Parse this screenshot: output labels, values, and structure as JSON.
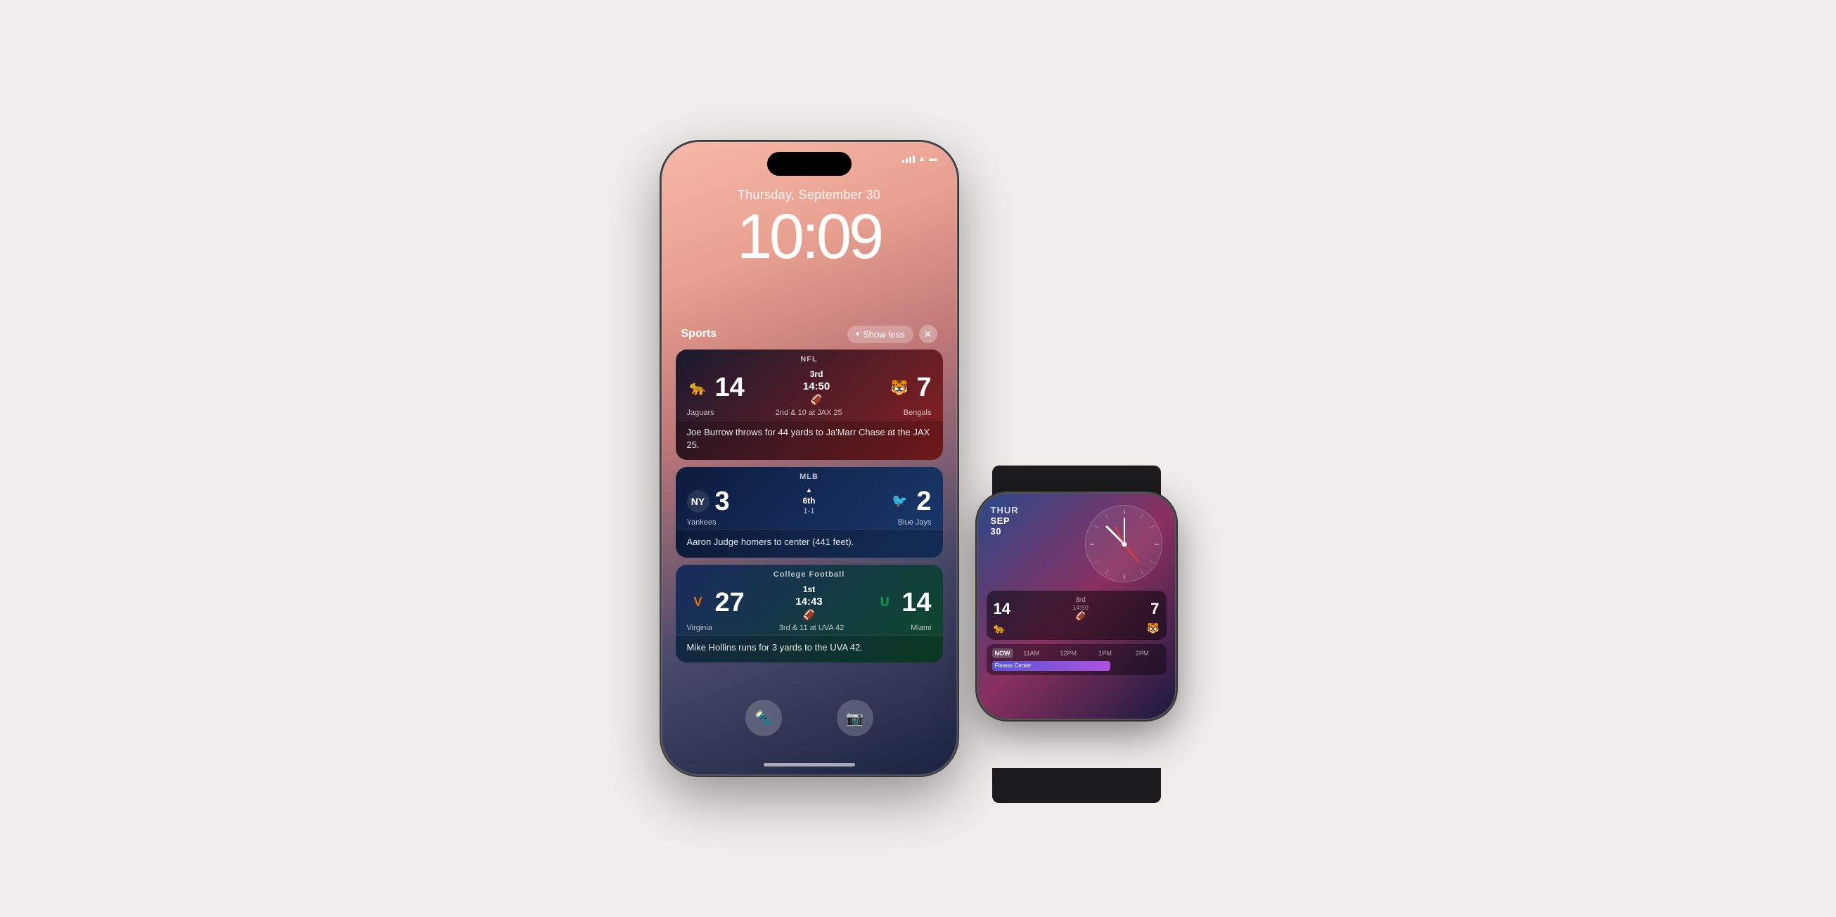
{
  "background_color": "#f0eeec",
  "iphone": {
    "date": "Thursday, September 30",
    "time": "10:09",
    "sports_label": "Sports",
    "show_less": "Show less",
    "nfl": {
      "league": "NFL",
      "team1": "Jaguars",
      "team1_score": "14",
      "team1_logo": "🐆",
      "team2": "Bengals",
      "team2_score": "7",
      "team2_logo": "🐯",
      "quarter": "3rd",
      "time": "14:50",
      "down_distance": "2nd & 10 at JAX 25",
      "play": "Joe Burrow throws for 44 yards to Ja'Marr Chase at the JAX 25."
    },
    "mlb": {
      "league": "MLB",
      "team1": "Yankees",
      "team1_score": "3",
      "team1_logo": "NY",
      "team2": "Blue Jays",
      "team2_score": "2",
      "team2_logo": "🐦",
      "inning": "6th",
      "inning_half": "▲",
      "count": "1-1",
      "play": "Aaron Judge homers to center (441 feet)."
    },
    "cfb": {
      "league": "College Football",
      "team1": "Virginia",
      "team1_score": "27",
      "team1_logo": "V",
      "team2": "Miami",
      "team2_score": "14",
      "team2_logo": "U",
      "quarter": "1st",
      "time": "14:43",
      "down_distance": "3rd & 11 at UVA 42",
      "play": "Mike Hollins runs for 3 yards to the UVA 42."
    }
  },
  "watch": {
    "day": "THUR",
    "month": "SEP",
    "date_num": "30",
    "nfl_score1": "14",
    "nfl_score2": "7",
    "nfl_quarter": "3rd",
    "nfl_time": "14:50",
    "calendar_times": [
      "NOW",
      "11AM",
      "12PM",
      "1PM",
      "2PM"
    ],
    "calendar_event": "Fitness Center"
  }
}
